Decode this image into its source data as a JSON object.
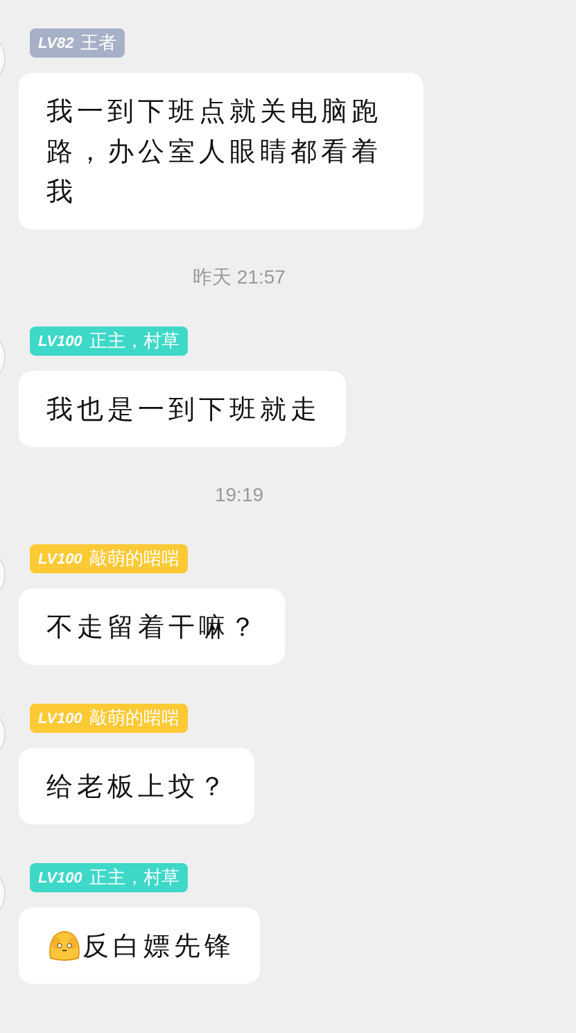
{
  "items": [
    {
      "kind": "message",
      "badge": {
        "level": "LV82",
        "name": "王者",
        "color": "#a6b0c6"
      },
      "text": "我一到下班点就关电脑跑路，办公室人眼睛都看着我",
      "emoji": false
    },
    {
      "kind": "time",
      "text": "昨天 21:57"
    },
    {
      "kind": "message",
      "badge": {
        "level": "LV100",
        "name": "正主，村草",
        "color": "#3ed8c8"
      },
      "text": "我也是一到下班就走",
      "emoji": false
    },
    {
      "kind": "time",
      "text": "19:19"
    },
    {
      "kind": "message",
      "badge": {
        "level": "LV100",
        "name": "敲萌的啱啱",
        "color": "#fdc935"
      },
      "text": "不走留着干嘛？",
      "emoji": false
    },
    {
      "kind": "message",
      "badge": {
        "level": "LV100",
        "name": "敲萌的啱啱",
        "color": "#fdc935"
      },
      "text": "给老板上坟？",
      "emoji": false
    },
    {
      "kind": "message",
      "badge": {
        "level": "LV100",
        "name": "正主，村草",
        "color": "#3ed8c8"
      },
      "text": "反白嫖先锋",
      "emoji": true
    }
  ]
}
